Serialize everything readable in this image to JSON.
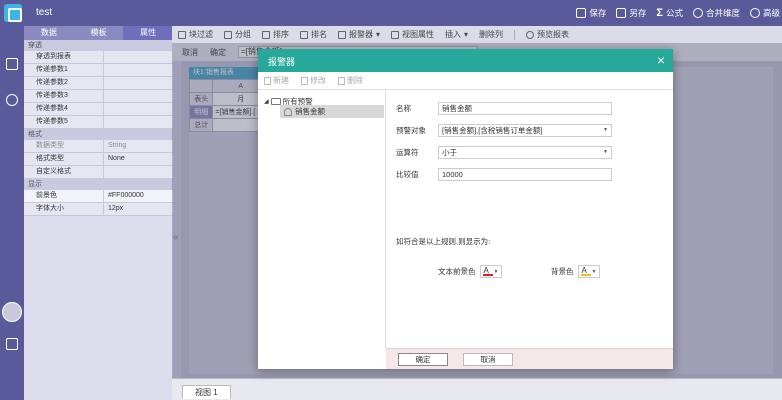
{
  "app": {
    "title": "test"
  },
  "top_actions": [
    {
      "label": "保存",
      "icon": "save-icon"
    },
    {
      "label": "另存",
      "icon": "save-as-icon"
    },
    {
      "label": "公式",
      "icon": "sigma-icon"
    },
    {
      "label": "合并维度",
      "icon": "merge-icon"
    },
    {
      "label": "高级",
      "icon": "settings-icon"
    }
  ],
  "panel": {
    "tabs": [
      "数据",
      "模板",
      "属性"
    ],
    "active_tab": "属性",
    "sections": [
      {
        "title": "穿透",
        "rows": [
          {
            "k": "穿透到报表",
            "v": ""
          },
          {
            "k": "传递参数1",
            "v": ""
          },
          {
            "k": "传递参数2",
            "v": ""
          },
          {
            "k": "传递参数3",
            "v": ""
          },
          {
            "k": "传递参数4",
            "v": ""
          },
          {
            "k": "传递参数5",
            "v": ""
          }
        ]
      },
      {
        "title": "格式",
        "rows": [
          {
            "k": "数据类型",
            "v": "String"
          },
          {
            "k": "格式类型",
            "v": "None"
          },
          {
            "k": "自定义格式",
            "v": ""
          }
        ]
      },
      {
        "title": "显示",
        "rows": [
          {
            "k": "前景色",
            "v": "#FF000000"
          },
          {
            "k": "字体大小",
            "v": "12px"
          }
        ]
      }
    ]
  },
  "toolbar": {
    "items": [
      "块过滤",
      "分组",
      "排序",
      "排名",
      "报警器",
      "视图属性",
      "插入",
      "删除列",
      "预览报表"
    ]
  },
  "subbar": {
    "cancel": "取消",
    "confirm": "确定",
    "formula": "=[销售金额]"
  },
  "sheet": {
    "tab": "块1:销售报表",
    "col_header": "A",
    "rows": [
      {
        "label": "表头",
        "value": "月"
      },
      {
        "label": "明细",
        "value": "=[销售金额].["
      },
      {
        "label": "总计",
        "value": ""
      }
    ]
  },
  "bottom": {
    "view_tab": "视图 1"
  },
  "dialog": {
    "title": "报警器",
    "close": "×",
    "toolbar": {
      "new": "新建",
      "edit": "修改",
      "delete": "删除"
    },
    "tree": {
      "root": "所有预警",
      "child": "销售金额"
    },
    "form": {
      "name_label": "名称",
      "name_value": "销售金额",
      "target_label": "预警对象",
      "target_value": "[销售金额],[含税销售订单金额]",
      "op_label": "运算符",
      "op_value": "小于",
      "cmp_label": "比较值",
      "cmp_value": "10000",
      "note": "如符合是以上规则,则显示为:",
      "fg_label": "文本前景色",
      "fg_color": "#e02020",
      "bg_label": "背景色",
      "bg_color": "#f0c020"
    },
    "buttons": {
      "ok": "确定",
      "cancel": "取消"
    }
  }
}
